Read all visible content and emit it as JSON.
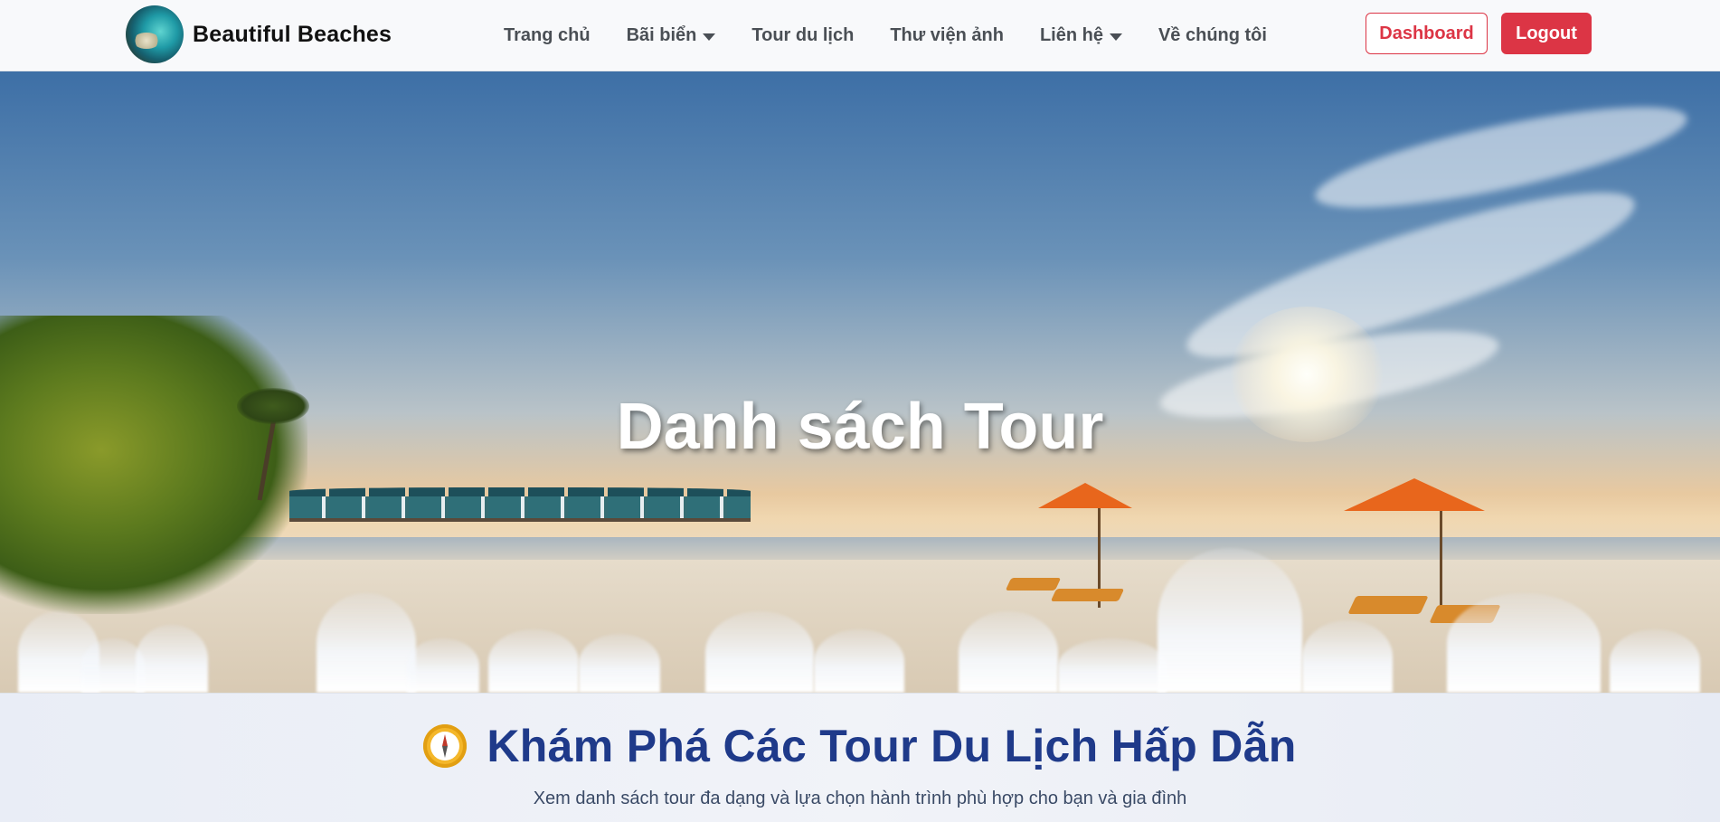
{
  "brand": {
    "name": "Beautiful Beaches"
  },
  "nav": {
    "items": [
      {
        "label": "Trang chủ",
        "dropdown": false
      },
      {
        "label": "Bãi biển",
        "dropdown": true
      },
      {
        "label": "Tour du lịch",
        "dropdown": false
      },
      {
        "label": "Thư viện ảnh",
        "dropdown": false
      },
      {
        "label": "Liên hệ",
        "dropdown": true
      },
      {
        "label": "Về chúng tôi",
        "dropdown": false
      }
    ],
    "dashboard_label": "Dashboard",
    "logout_label": "Logout"
  },
  "hero": {
    "title": "Danh sách Tour"
  },
  "section": {
    "icon": "compass-icon",
    "title": "Khám Phá Các Tour Du Lịch Hấp Dẫn",
    "subtitle": "Xem danh sách tour đa dạng và lựa chọn hành trình phù hợp cho bạn và gia đình"
  },
  "colors": {
    "accent_red": "#dc3545",
    "heading_blue": "#1f3a8a",
    "nav_text": "#4a4f55"
  }
}
